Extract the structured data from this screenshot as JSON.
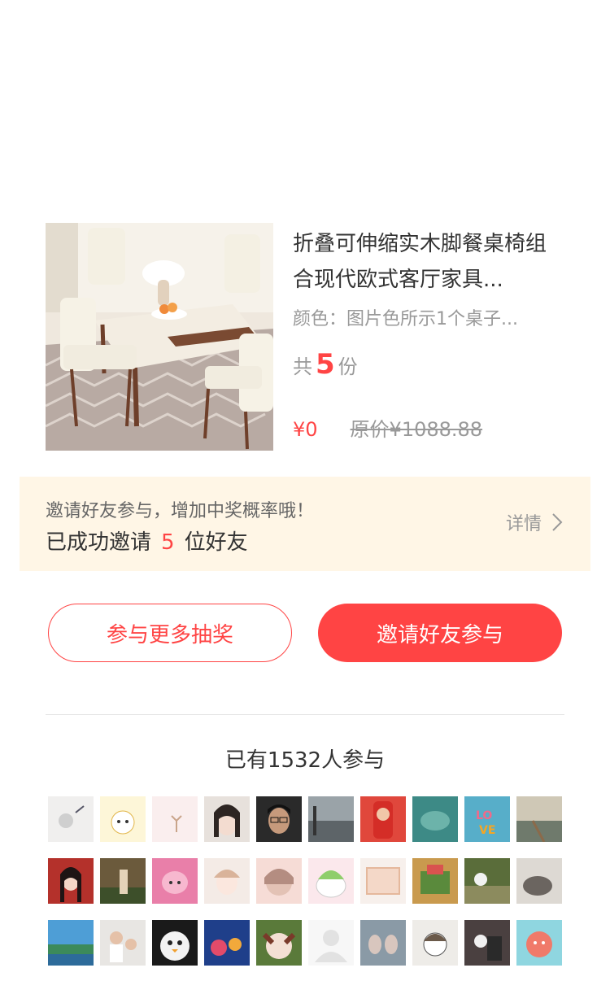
{
  "product": {
    "title": "折叠可伸缩实木脚餐桌椅组合现代欧式客厅家具...",
    "spec": "颜色：图片色所示1个桌子...",
    "count_prefix": "共",
    "count_value": "5",
    "count_suffix": "份",
    "price_current": "¥0",
    "price_original": "原价¥1088.88"
  },
  "invite": {
    "hint": "邀请好友参与，增加中奖概率哦！",
    "status_prefix": "已成功邀请",
    "status_count": "5",
    "status_suffix": "位好友",
    "details_label": "详情"
  },
  "buttons": {
    "more_draws": "参与更多抽奖",
    "invite_friends": "邀请好友参与"
  },
  "participants": {
    "count_label": "已有1532人参与"
  },
  "colors": {
    "accent": "#ff4444",
    "banner_bg": "#fff6e6"
  }
}
